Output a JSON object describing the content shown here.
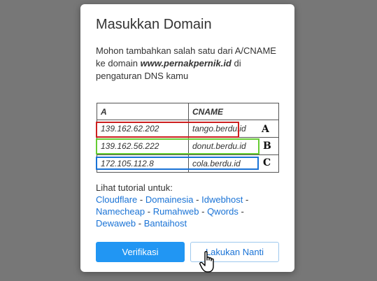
{
  "modal": {
    "title": "Masukkan Domain",
    "message_pre": "Mohon tambahkan salah satu dari A/CNAME ke domain ",
    "domain": "www.pernakpernik.id",
    "message_post": " di pengaturan DNS kamu"
  },
  "dns_table": {
    "headers": [
      "A",
      "CNAME"
    ],
    "rows": [
      {
        "a": "139.162.62.202",
        "cname": "tango.berdu.id",
        "marker": "A",
        "highlight": "#cc1f1f"
      },
      {
        "a": "139.162.56.222",
        "cname": "donut.berdu.id",
        "marker": "B",
        "highlight": "#66cc33"
      },
      {
        "a": "172.105.112.8",
        "cname": "cola.berdu.id",
        "marker": "C",
        "highlight": "#1a73d6"
      }
    ]
  },
  "tutorial": {
    "label": "Lihat tutorial untuk:",
    "links": [
      "Cloudflare",
      "Domainesia",
      "Idwebhost",
      "Namecheap",
      "Rumahweb",
      "Qwords",
      "Dewaweb",
      "Bantaihost"
    ],
    "separator": "-"
  },
  "buttons": {
    "verify": "Verifikasi",
    "later": "Lakukan Nanti"
  },
  "colors": {
    "primary": "#2196f3",
    "link": "#1a73d6",
    "overlay": "#777777"
  },
  "icons": {
    "cursor": "hand-pointer-icon"
  }
}
